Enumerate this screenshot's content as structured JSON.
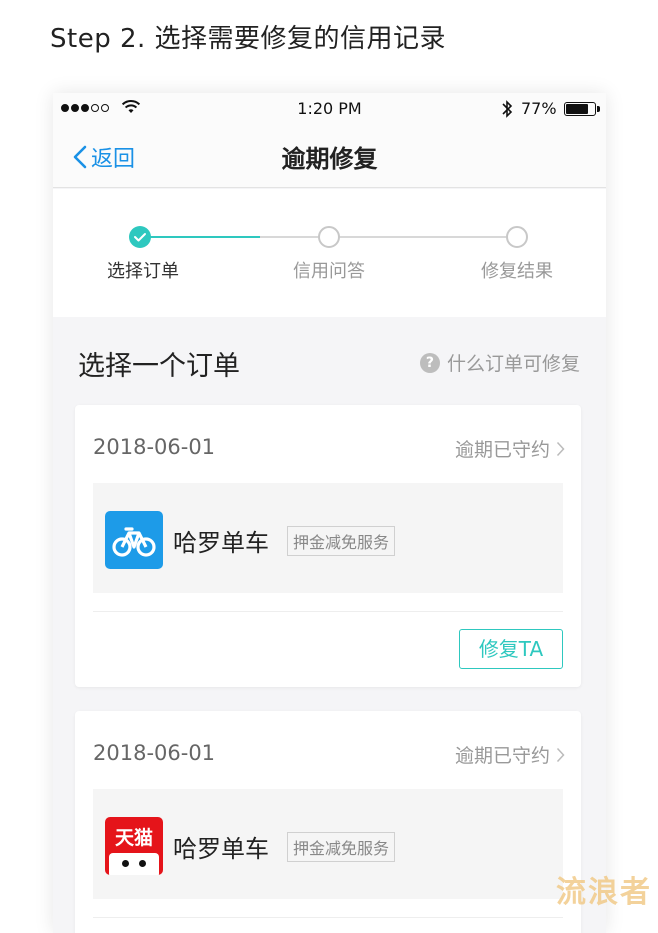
{
  "heading": "Step 2. 选择需要修复的信用记录",
  "status_bar": {
    "time": "1:20 PM",
    "battery": "77%",
    "battery_level": 0.77
  },
  "nav": {
    "back_label": "返回",
    "title": "逾期修复"
  },
  "stepper": {
    "steps": [
      {
        "label": "选择订单",
        "state": "done"
      },
      {
        "label": "信用问答",
        "state": "pending"
      },
      {
        "label": "修复结果",
        "state": "pending"
      }
    ],
    "accent": "#2ec8bf"
  },
  "section": {
    "title": "选择一个订单",
    "help_label": "什么订单可修复",
    "help_icon": "?"
  },
  "orders": [
    {
      "date": "2018-06-01",
      "status": "逾期已守约",
      "merchant": "哈罗单车",
      "tag": "押金减免服务",
      "logo": "hellobike-logo",
      "action": "修复TA"
    },
    {
      "date": "2018-06-01",
      "status": "逾期已守约",
      "merchant": "哈罗单车",
      "tag": "押金减免服务",
      "logo": "tmall-logo",
      "logo_text": "天猫"
    }
  ],
  "watermark": "流浪者",
  "colors": {
    "link_blue": "#1a91e6",
    "hellobike_blue": "#1d9be8",
    "tmall_red": "#e5141a"
  }
}
